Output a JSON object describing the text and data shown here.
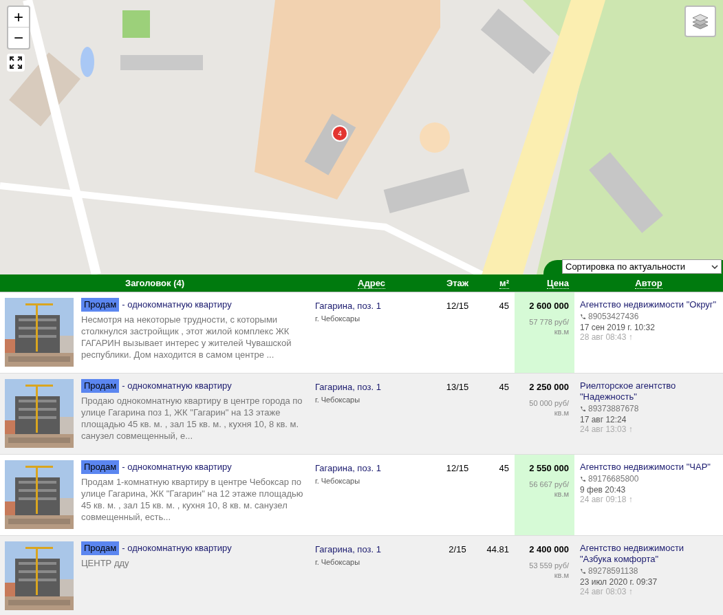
{
  "map": {
    "kind": "picture",
    "marker": {
      "count": "4"
    },
    "controls": {
      "zoom_in": "+",
      "zoom_out": "−"
    }
  },
  "sort": {
    "value": "Сортировка по актуальности"
  },
  "table": {
    "columns": [
      {
        "label": "Заголовок (4)",
        "sortable": false
      },
      {
        "label": "Адрес",
        "sortable": true
      },
      {
        "label": "Этаж",
        "sortable": false
      },
      {
        "label": "м²",
        "sortable": true
      },
      {
        "label": "Цена",
        "sortable": true
      },
      {
        "label": "Автор",
        "sortable": true
      }
    ],
    "rows": [
      {
        "tag": "Продам",
        "title": "- однокомнатную квартиру",
        "description": "Несмотря на некоторые трудности, с которыми столкнулся застройщик , этот жилой комплекс ЖК ГАГАРИН вызывает интерес у жителей Чувашской республики. Дом находится в самом центре ...",
        "address": "Гагарина, поз. 1",
        "city": "г. Чебоксары",
        "floor": "12/15",
        "area": "45",
        "price": "2 600 000",
        "price_per_m": "57 778 руб/ кв.м",
        "price_highlighted": true,
        "author": "Агентство недвижимости \"Округ\"",
        "phone": "89053427436",
        "date": "17 сен 2019 г. 10:32",
        "updated": "28 авг 08:43 ↑"
      },
      {
        "tag": "Продам",
        "title": "- однокомнатную квартиру",
        "description": "Продаю однокомнатную квартиру в центре города по улице Гагарина поз 1, ЖК \"Гагарин\" на 13 этаже площадью 45 кв. м. , зал 15 кв. м. , кухня 10, 8 кв. м. санузел совмещенный, е...",
        "address": "Гагарина, поз. 1",
        "city": "г. Чебоксары",
        "floor": "13/15",
        "area": "45",
        "price": "2 250 000",
        "price_per_m": "50 000 руб/ кв.м",
        "price_highlighted": false,
        "author": "Риелторское агентство \"Надежность\"",
        "phone": "89373887678",
        "date": "17 авг 12:24",
        "updated": "24 авг 13:03 ↑"
      },
      {
        "tag": "Продам",
        "title": "- однокомнатную квартиру",
        "description": "Продам 1-комнатную квартиру в центре Чебоксар по улице Гагарина, ЖК \"Гагарин\" на 12 этаже площадью 45 кв. м. , зал 15 кв. м. , кухня 10, 8 кв. м. санузел совмещенный, есть...",
        "address": "Гагарина, поз. 1",
        "city": "г. Чебоксары",
        "floor": "12/15",
        "area": "45",
        "price": "2 550 000",
        "price_per_m": "56 667 руб/ кв.м",
        "price_highlighted": true,
        "author": "Агентство недвижимости \"ЧАР\"",
        "phone": "89176685800",
        "date": "9 фев 20:43",
        "updated": "24 авг 09:18 ↑"
      },
      {
        "tag": "Продам",
        "title": "- однокомнатную квартиру",
        "description": "ЦЕНТР дду",
        "address": "Гагарина, поз. 1",
        "city": "г. Чебоксары",
        "floor": "2/15",
        "area": "44.81",
        "price": "2 400 000",
        "price_per_m": "53 559 руб/ кв.м",
        "price_highlighted": false,
        "author": "Агентство недвижимости \"Азбука комфорта\"",
        "phone": "89278591138",
        "date": "23 июл 2020 г. 09:37",
        "updated": "24 авг 08:03 ↑"
      }
    ]
  }
}
